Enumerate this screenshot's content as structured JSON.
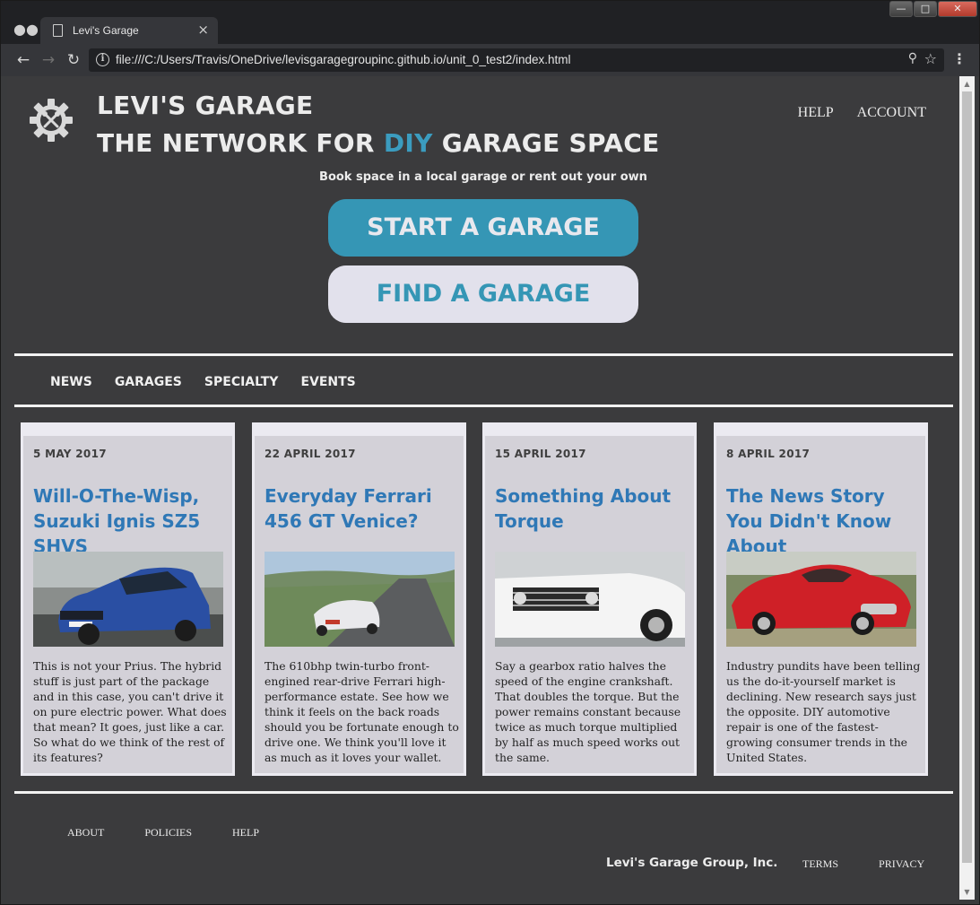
{
  "browser": {
    "tab_title": "Levi's Garage",
    "url": "file:///C:/Users/Travis/OneDrive/levisgaragegroupinc.github.io/unit_0_test2/index.html",
    "icons": [
      "incognito-icon",
      "page-icon",
      "close-icon",
      "back-icon",
      "forward-icon",
      "reload-icon",
      "info-icon",
      "zoom-icon",
      "star-icon",
      "menu-icon"
    ]
  },
  "header": {
    "brand_line1": "LEVI'S GARAGE",
    "brand_line2_prefix": "THE NETWORK FOR ",
    "brand_line2_accent": "DIY",
    "brand_line2_suffix": " GARAGE SPACE",
    "accent_color": "#3b9cbf",
    "nav": [
      "HELP",
      "ACCOUNT"
    ]
  },
  "hero": {
    "tagline": "Book space in a local garage or rent out your own",
    "start_label": "START A GARAGE",
    "find_label": "FIND A GARAGE"
  },
  "categories": [
    "NEWS",
    "GARAGES",
    "SPECIALTY",
    "EVENTS"
  ],
  "articles": [
    {
      "date": "5 MAY 2017",
      "title": "Will-O-The-Wisp, Suzuki Ignis SZ5 SHVS",
      "text": "This is not your Prius. The hybrid stuff is just part of the package and in this case, you can't drive it on pure electric power. What does that mean? It goes, just like a car. So what do we think of the rest of its features?"
    },
    {
      "date": "22 APRIL 2017",
      "title": "Everyday Ferrari 456 GT Venice?",
      "text": "The 610bhp twin-turbo front-engined rear-drive Ferrari high-performance estate. See how we think it feels on the back roads should you be fortunate enough to drive one. We think you'll love it as much as it loves your wallet."
    },
    {
      "date": "15 APRIL 2017",
      "title": "Something About Torque",
      "text": "Say a gearbox ratio halves the speed of the engine crankshaft. That doubles the torque. But the power remains constant because twice as much torque multiplied by half as much speed works out the same."
    },
    {
      "date": "8 APRIL 2017",
      "title": "The News Story You Didn't Know About",
      "text": "Industry pundits have been telling us the do-it-yourself market is declining. New research says just the opposite. DIY automotive repair is one of the fastest-growing consumer trends in the United States."
    }
  ],
  "footer": {
    "nav": [
      "ABOUT",
      "POLICIES",
      "HELP"
    ],
    "copyright": "Levi's Garage Group, Inc.",
    "legal": [
      "TERMS",
      "PRIVACY"
    ]
  }
}
